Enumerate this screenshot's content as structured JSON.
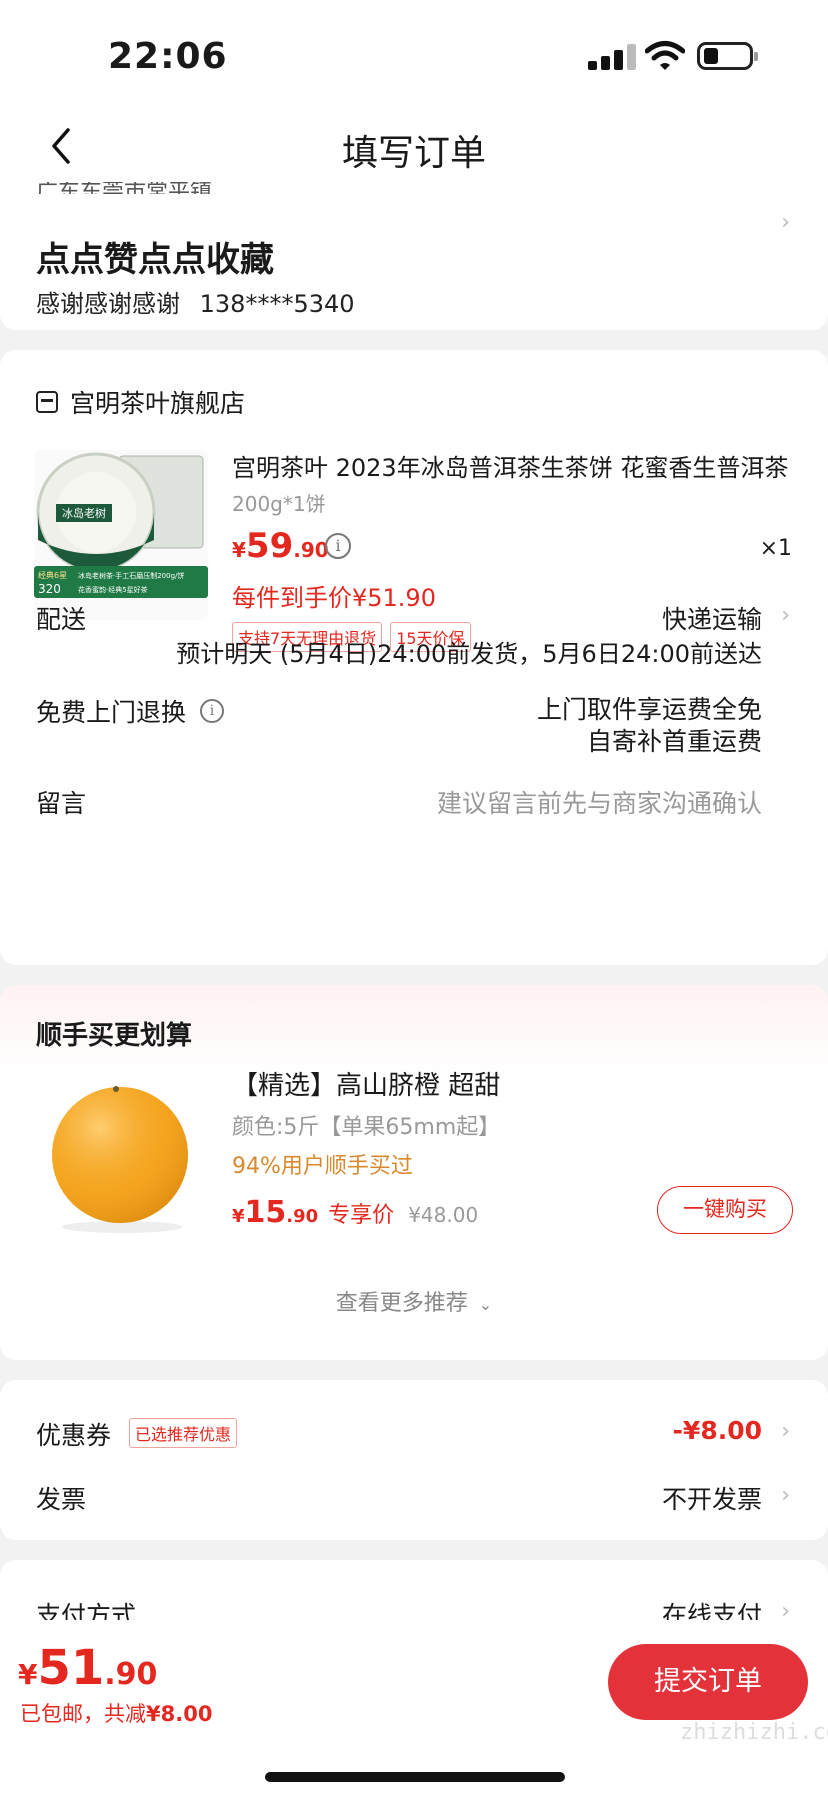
{
  "status_bar": {
    "time": "22:06"
  },
  "nav": {
    "title": "填写订单"
  },
  "address": {
    "region": "广东东莞市常平镇",
    "main": "点点赞点点收藏",
    "name": "感谢感谢感谢",
    "phone": "138****5340"
  },
  "store": {
    "name": "宫明茶叶旗舰店"
  },
  "product": {
    "title": "宫明茶叶 2023年冰岛普洱茶生茶饼 花蜜香生普洱茶",
    "spec": "200g*1饼",
    "price_symbol": "¥",
    "price_int": "59",
    "price_dec": ".90",
    "quantity": "×1",
    "deal_price": "每件到手价¥51.90",
    "tags": [
      "支持7天无理由退货",
      "15天价保"
    ],
    "image_text": {
      "name": "冰岛老树",
      "badge": "经典6星",
      "num": "320",
      "line1": "冰岛老树茶·手工石磨压制200g/饼",
      "line2": "花香蜜韵·经典5星好茶"
    }
  },
  "delivery": {
    "label": "配送",
    "method": "快递运输",
    "estimate": "预计明天 (5月4日)24:00前发货，5月6日24:00前送达"
  },
  "return_service": {
    "label": "免费上门退换",
    "line1": "上门取件享运费全免",
    "line2": "自寄补首重运费"
  },
  "message": {
    "label": "留言",
    "placeholder": "建议留言前先与商家沟通确认"
  },
  "recommend": {
    "heading": "顺手买更划算",
    "title": "【精选】高山脐橙 超甜",
    "spec": "颜色:5斤【单果65mm起】",
    "bought": "94%用户顺手买过",
    "price_symbol": "¥",
    "price_int": "15",
    "price_dec": ".90",
    "exclusive": "专享价",
    "original": "¥48.00",
    "buy_label": "一键购买",
    "more": "查看更多推荐"
  },
  "coupon": {
    "label": "优惠券",
    "badge": "已选推荐优惠",
    "amount": "-¥8.00"
  },
  "invoice": {
    "label": "发票",
    "value": "不开发票"
  },
  "payment": {
    "label": "支付方式",
    "value": "在线支付"
  },
  "bottom": {
    "price_symbol": "¥",
    "price_int": "51",
    "price_dec": ".90",
    "shipping": "已包邮，共减",
    "discount": "¥8.00",
    "submit": "提交订单",
    "watermark": "zhizhizhi.com"
  },
  "colors": {
    "accent": "#e4281f",
    "button": "#e4323a",
    "orange_text": "#d9892d"
  }
}
